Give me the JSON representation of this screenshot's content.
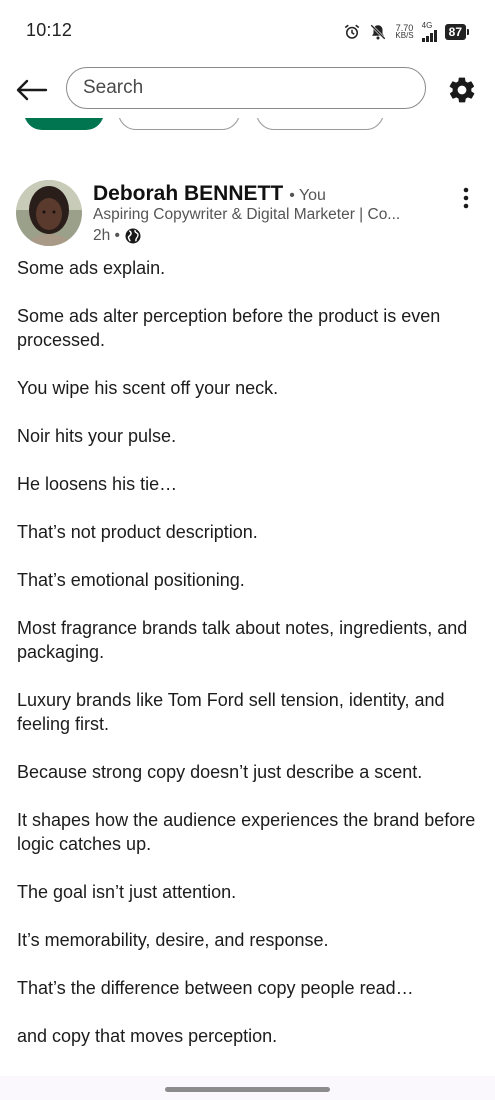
{
  "status_bar": {
    "time": "10:12",
    "speed_value": "7.70",
    "speed_unit": "KB/S",
    "network": "4G",
    "battery": "87"
  },
  "header": {
    "search_placeholder": "Search",
    "icons": {
      "back": "back-arrow-icon",
      "settings": "gear-icon"
    }
  },
  "filter_chips": {
    "active_color": "#01754f"
  },
  "post": {
    "author_name": "Deborah BENNETT",
    "author_relation": "• You",
    "author_headline": "Aspiring Copywriter & Digital Marketer | Co...",
    "time_ago": "2h •",
    "visibility_icon": "globe-icon",
    "paragraphs": [
      "Some ads explain.",
      "Some ads alter perception before the product is even processed.",
      "You wipe his scent off your neck.",
      "Noir hits your pulse.",
      "He loosens his tie…",
      "That’s not product description.",
      "That’s emotional positioning.",
      "Most fragrance brands talk about notes, ingredients, and packaging.",
      "Luxury brands like Tom Ford sell tension, identity, and feeling first.",
      "Because strong copy doesn’t just describe a scent.",
      "It shapes how the audience experiences the brand before logic catches up.",
      "The goal isn’t just attention.",
      "It’s memorability, desire, and response.",
      "That’s the difference between copy people read…",
      "and copy that moves perception."
    ]
  }
}
